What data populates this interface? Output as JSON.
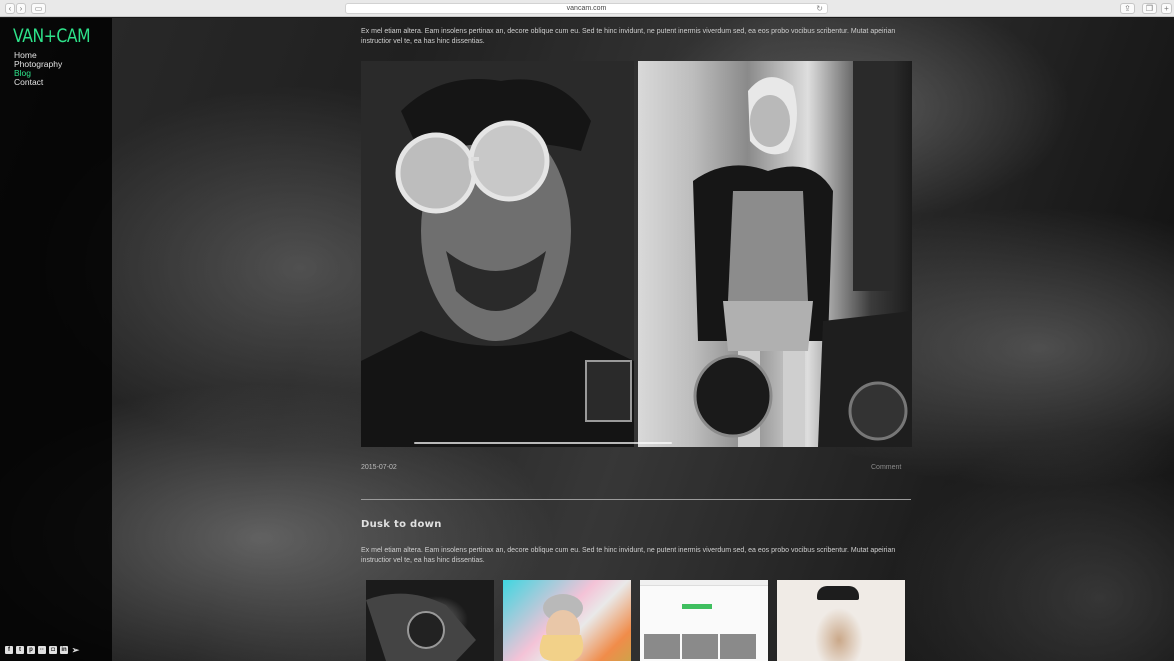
{
  "browser": {
    "url": "vancam.com",
    "back_icon": "chevron-left-icon",
    "forward_icon": "chevron-right-icon",
    "reload_icon": "reload-icon"
  },
  "site": {
    "logo": "VAN+CAM",
    "nav": [
      {
        "label": "Home"
      },
      {
        "label": "Photography"
      },
      {
        "label": "Blog"
      },
      {
        "label": "Contact"
      }
    ],
    "accent_color": "#2ee38a"
  },
  "post1": {
    "intro": "Ex mel etiam altera. Eam insolens pertinax an, decore oblique cum eu. Sed te hinc invidunt, ne putent inermis viverdum sed, ea eos probo vocibus scribentur. Mutat apeirian instructior vel te, ea has hinc dissentias.",
    "date": "2015-07-02",
    "comment": "Comment"
  },
  "post2": {
    "title": "Dusk to down",
    "intro": "Ex mel etiam altera. Eam insolens pertinax an, decore oblique cum eu. Sed te hinc invidunt, ne putent inermis viverdum sed, ea eos probo vocibus scribentur. Mutat apeirian instructior vel te, ea has hinc dissentias."
  },
  "socials": [
    "facebook-icon",
    "twitter-icon",
    "pinterest-icon",
    "flickr-icon",
    "instagram-icon",
    "linkedin-icon",
    "arrow-icon"
  ]
}
